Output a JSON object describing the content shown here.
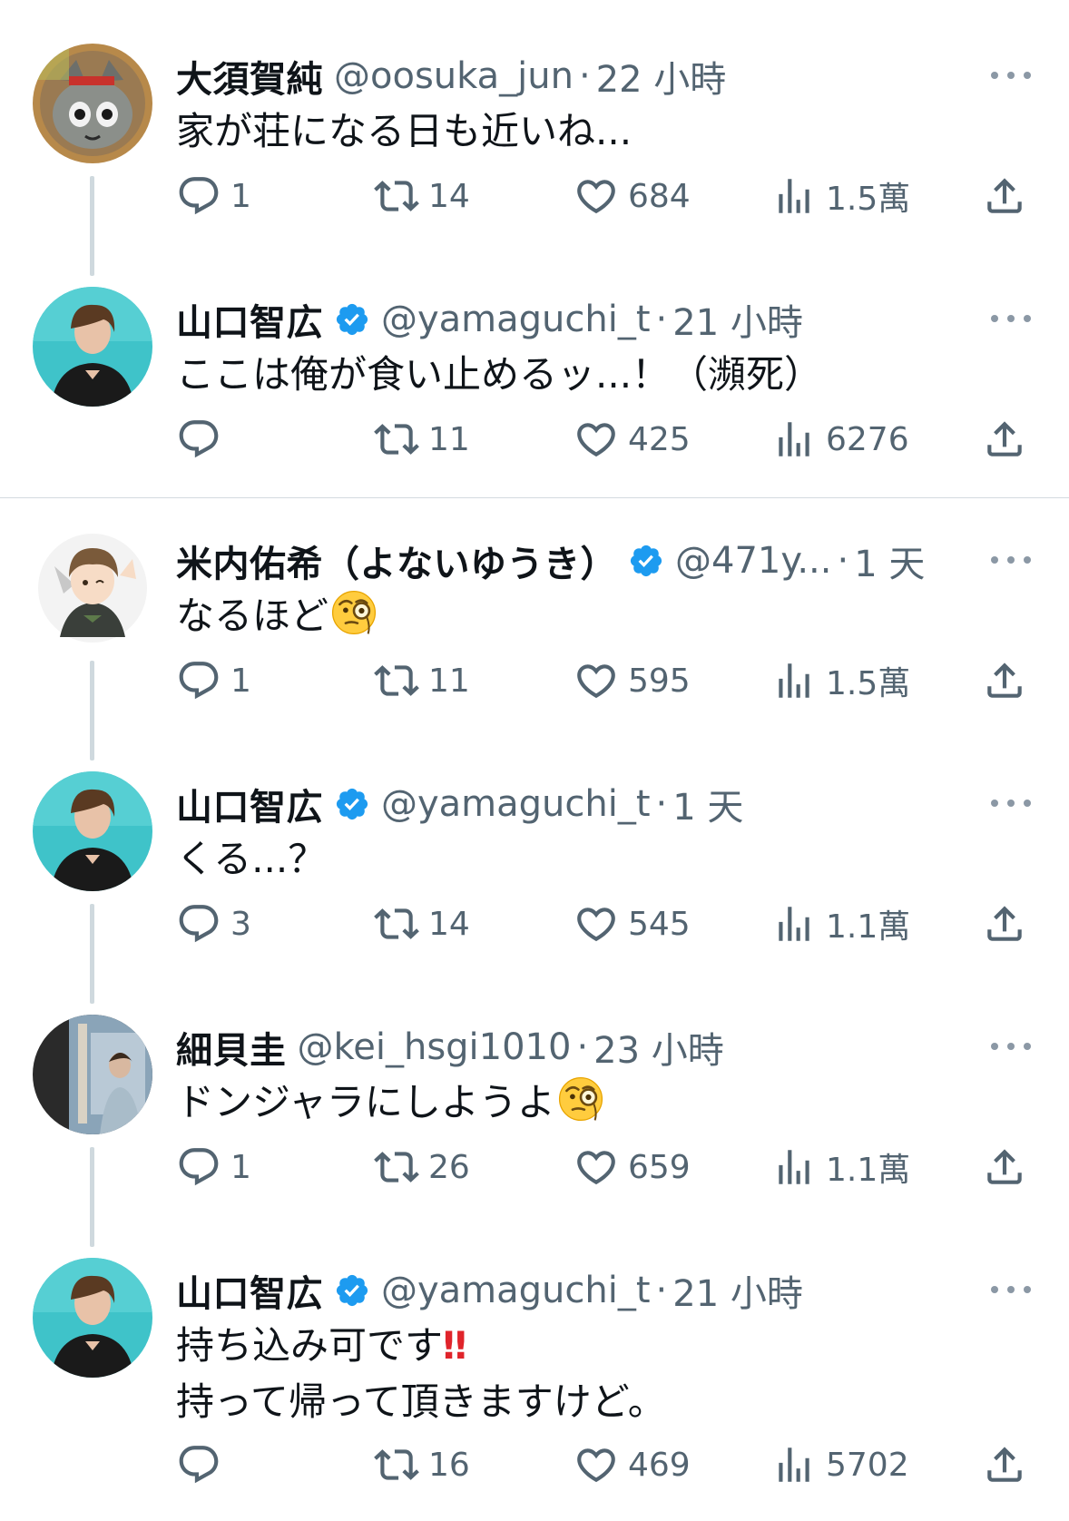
{
  "tweets": [
    {
      "name": "大須賀純",
      "handle": "@oosuka_jun",
      "dot": "·",
      "time": "22 小時",
      "text": "家が荘になる日も近いね...",
      "replies": "1",
      "retweets": "14",
      "likes": "684",
      "views": "1.5萬",
      "avatar": "plush-cat-avatar"
    },
    {
      "name": "山口智広",
      "handle": "@yamaguchi_t",
      "dot": "·",
      "time": "21 小時",
      "text": "ここは俺が食い止めるッ...！（瀕死）",
      "replies": "",
      "retweets": "11",
      "likes": "425",
      "views": "6276",
      "avatar": "man-portrait-avatar"
    },
    {
      "name": "米内佑希（よないゆうき）",
      "handle": "@471y...",
      "dot": "·",
      "time": "1 天",
      "text": "なるほど",
      "emoji": "face-with-monocle",
      "replies": "1",
      "retweets": "11",
      "likes": "595",
      "views": "1.5萬",
      "avatar": "anime-character-avatar"
    },
    {
      "name": "山口智広",
      "handle": "@yamaguchi_t",
      "dot": "·",
      "time": "1 天",
      "text": "くる...？",
      "replies": "3",
      "retweets": "14",
      "likes": "545",
      "views": "1.1萬",
      "avatar": "man-portrait-avatar"
    },
    {
      "name": "細貝圭",
      "handle": "@kei_hsgi1010",
      "dot": "·",
      "time": "23 小時",
      "text": "ドンジャラにしようよ",
      "emoji": "face-with-monocle",
      "replies": "1",
      "retweets": "26",
      "likes": "659",
      "views": "1.1萬",
      "avatar": "photo-avatar"
    },
    {
      "name": "山口智広",
      "handle": "@yamaguchi_t",
      "dot": "·",
      "time": "21 小時",
      "text_line1": "持ち込み可です",
      "text_line1_mark": "‼",
      "text_line2": "持って帰って頂きますけど。",
      "replies": "",
      "retweets": "16",
      "likes": "469",
      "views": "5702",
      "avatar": "man-portrait-avatar"
    }
  ],
  "colors": {
    "text": "#0f1419",
    "secondary": "#536471",
    "verified": "#1d9bf0",
    "divider": "#cfd9de",
    "accent_red": "#e0242b"
  },
  "icons": {
    "reply": "reply-icon",
    "retweet": "retweet-icon",
    "like": "heart-icon",
    "views": "views-chart-icon",
    "share": "share-icon",
    "more": "more-dots-icon",
    "verified": "verified-badge-icon"
  }
}
